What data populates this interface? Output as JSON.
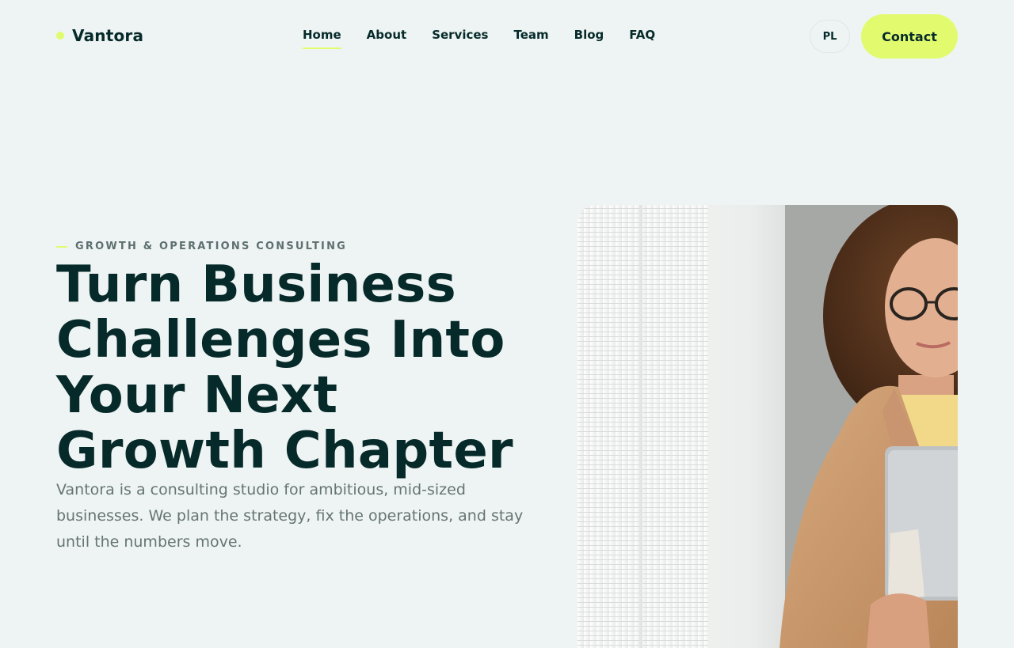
{
  "brand": {
    "name": "Vantora"
  },
  "nav": {
    "items": [
      {
        "label": "Home"
      },
      {
        "label": "About"
      },
      {
        "label": "Services"
      },
      {
        "label": "Team"
      },
      {
        "label": "Blog"
      },
      {
        "label": "FAQ"
      }
    ],
    "active": "Home"
  },
  "header": {
    "lang_label": "PL",
    "contact_label": "Contact"
  },
  "hero": {
    "eyebrow": "GROWTH & OPERATIONS CONSULTING",
    "title": "Turn Business Challenges Into Your Next Growth Chapter",
    "description": "Vantora is a consulting studio for ambitious, mid-sized businesses. We plan the strategy, fix the operations, and stay until the numbers move."
  },
  "colors": {
    "background": "#eef4f3",
    "accent": "#e2fb6e",
    "text": "#062a2a",
    "muted": "#667474"
  }
}
